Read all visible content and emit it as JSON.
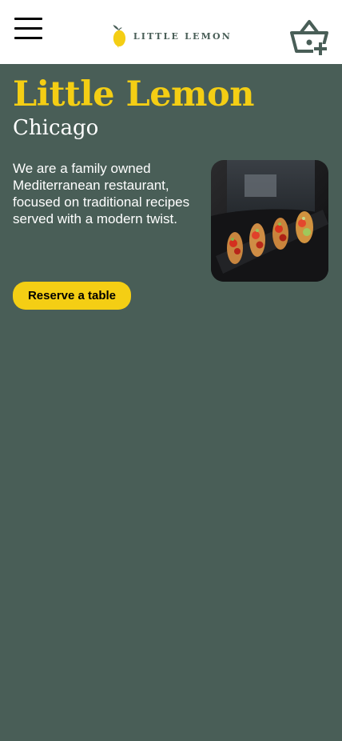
{
  "header": {
    "logo_text": "LITTLE LEMON",
    "menu_icon": "hamburger-menu-icon",
    "cart_icon": "basket-add-icon"
  },
  "hero": {
    "title": "Little Lemon",
    "subtitle": "Chicago",
    "description": "We are a family owned Mediterranean restaurant, focused on traditional recipes served with a modern twist.",
    "reserve_label": "Reserve a table",
    "image_alt": "Bruschetta served on a slate board"
  },
  "colors": {
    "primary_green": "#495e57",
    "primary_yellow": "#f4ce14",
    "header_bg": "#ffffff"
  }
}
